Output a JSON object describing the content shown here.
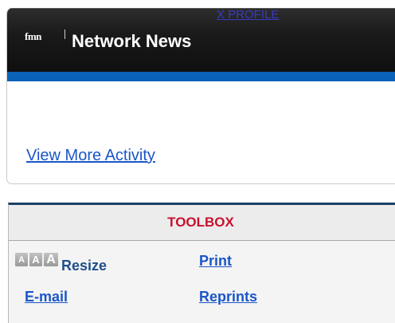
{
  "network_news": {
    "profile_link": "X PROFILE",
    "logo_text": "fmn",
    "title": "Network News",
    "view_more": "View More Activity"
  },
  "toolbox": {
    "title": "TOOLBOX",
    "resize": {
      "glyphs": [
        "A",
        "A",
        "A"
      ],
      "label": "Resize"
    },
    "print": "Print",
    "email": "E-mail",
    "reprints": "Reprints"
  },
  "colors": {
    "header_dark": "#1a1a1a",
    "accent_blue_bar": "#0b63b8",
    "link_blue": "#1a56c8",
    "toolbox_title_red": "#c8102e",
    "toolbox_top_border": "#1d3f66"
  },
  "icons": {
    "resize_buttons": "text-size-aaa-icon",
    "network_logo": "fmn-logo-icon"
  }
}
